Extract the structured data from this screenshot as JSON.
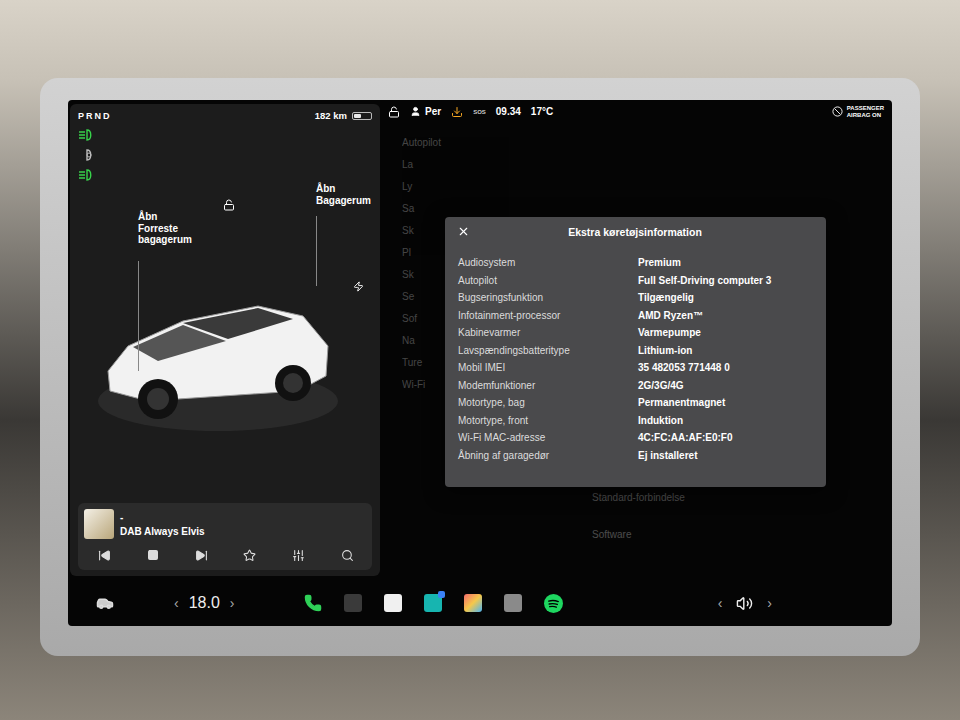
{
  "status_bar": {
    "gear": "PRND",
    "range": "182 km",
    "battery_level": 0.45,
    "user": "Per",
    "sos": "SOS",
    "time": "09.34",
    "temperature": "17°C",
    "airbag": [
      "PASSENGER",
      "AIRBAG ON"
    ]
  },
  "indicators": [
    {
      "kind": "headlight",
      "on": true
    },
    {
      "kind": "auto",
      "on": false
    },
    {
      "kind": "parking",
      "on": true
    }
  ],
  "car_view": {
    "front_trunk": [
      "Åbn",
      "Forreste",
      "bagagerum"
    ],
    "rear_trunk": [
      "Åbn",
      "Bagagerum"
    ]
  },
  "media": {
    "title": "-",
    "station": "DAB Always Elvis"
  },
  "settings_menu": [
    {
      "label": "Autopilot"
    },
    {
      "label": "La"
    },
    {
      "label": "Ly"
    },
    {
      "label": "Sa"
    },
    {
      "label": "Sk"
    },
    {
      "label": "Pl"
    },
    {
      "label": "Sk"
    },
    {
      "label": "Se"
    },
    {
      "label": "Sof"
    },
    {
      "label": "Na"
    },
    {
      "label": "Ture"
    },
    {
      "label": "Wi-Fi"
    }
  ],
  "settings_content": [
    "Standard-forbindelse",
    "Software"
  ],
  "modal": {
    "title": "Ekstra køretøjsinformation",
    "rows": [
      {
        "label": "Audiosystem",
        "value": "Premium"
      },
      {
        "label": "Autopilot",
        "value": "Full Self-Driving computer 3"
      },
      {
        "label": "Bugseringsfunktion",
        "value": "Tilgængelig"
      },
      {
        "label": "Infotainment-processor",
        "value": "AMD Ryzen™"
      },
      {
        "label": "Kabinevarmer",
        "value": "Varmepumpe"
      },
      {
        "label": "Lavspændingsbatteritype",
        "value": "Lithium-ion"
      },
      {
        "label": "Mobil IMEI",
        "value": "35 482053 771448 0"
      },
      {
        "label": "Modemfunktioner",
        "value": "2G/3G/4G"
      },
      {
        "label": "Motortype, bag",
        "value": "Permanentmagnet"
      },
      {
        "label": "Motortype, front",
        "value": "Induktion"
      },
      {
        "label": "Wi-Fi MAC-adresse",
        "value": "4C:FC:AA:AF:E0:F0"
      },
      {
        "label": "Åbning af garagedør",
        "value": "Ej installeret"
      }
    ]
  },
  "dock": {
    "temp_left": "‹",
    "temperature": "18.0",
    "temp_right": "›",
    "vol_left": "‹",
    "vol_right": "›"
  }
}
